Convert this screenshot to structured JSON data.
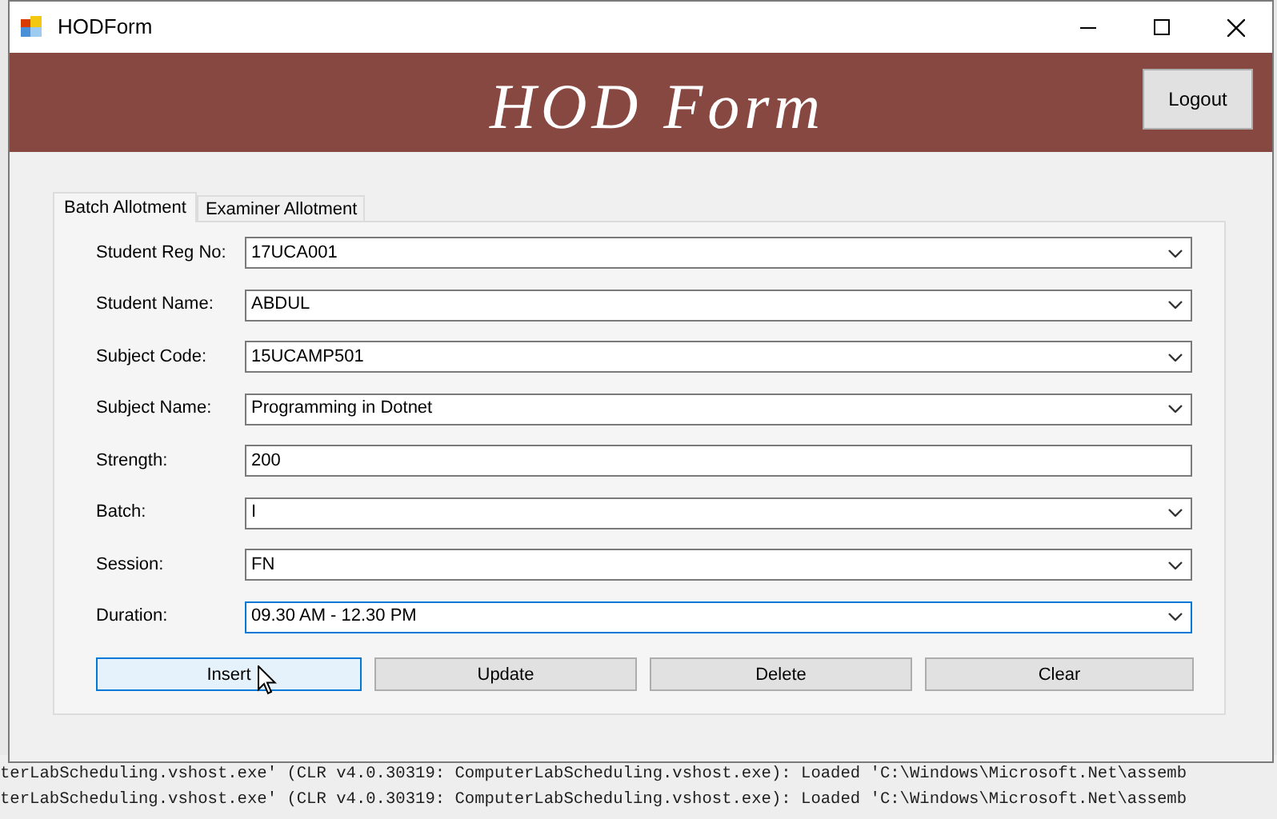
{
  "window": {
    "title": "HODForm"
  },
  "header": {
    "title": "HOD Form",
    "logout_button": "Logout"
  },
  "tabs": [
    {
      "label": "Batch Allotment",
      "selected": true
    },
    {
      "label": "Examiner Allotment",
      "selected": false
    }
  ],
  "fields": [
    {
      "label": "Student Reg No:",
      "kind": "combo",
      "value": "17UCA001",
      "focused": false
    },
    {
      "label": "Student Name:",
      "kind": "combo",
      "value": "ABDUL",
      "focused": false
    },
    {
      "label": "Subject Code:",
      "kind": "combo",
      "value": "15UCAMP501",
      "focused": false
    },
    {
      "label": "Subject Name:",
      "kind": "combo",
      "value": "Programming in Dotnet",
      "focused": false
    },
    {
      "label": "Strength:",
      "kind": "text",
      "value": "200",
      "focused": false
    },
    {
      "label": "Batch:",
      "kind": "combo",
      "value": "I",
      "focused": false
    },
    {
      "label": "Session:",
      "kind": "combo",
      "value": "FN",
      "focused": false
    },
    {
      "label": "Duration:",
      "kind": "combo",
      "value": "09.30 AM - 12.30 PM",
      "focused": true
    }
  ],
  "buttons": [
    {
      "label": "Insert",
      "hovered": true
    },
    {
      "label": "Update",
      "hovered": false
    },
    {
      "label": "Delete",
      "hovered": false
    },
    {
      "label": "Clear",
      "hovered": false
    }
  ],
  "console_lines": [
    "terLabScheduling.vshost.exe' (CLR v4.0.30319: ComputerLabScheduling.vshost.exe): Loaded 'C:\\Windows\\Microsoft.Net\\assemb",
    "terLabScheduling.vshost.exe' (CLR v4.0.30319: ComputerLabScheduling.vshost.exe): Loaded 'C:\\Windows\\Microsoft.Net\\assemb"
  ]
}
